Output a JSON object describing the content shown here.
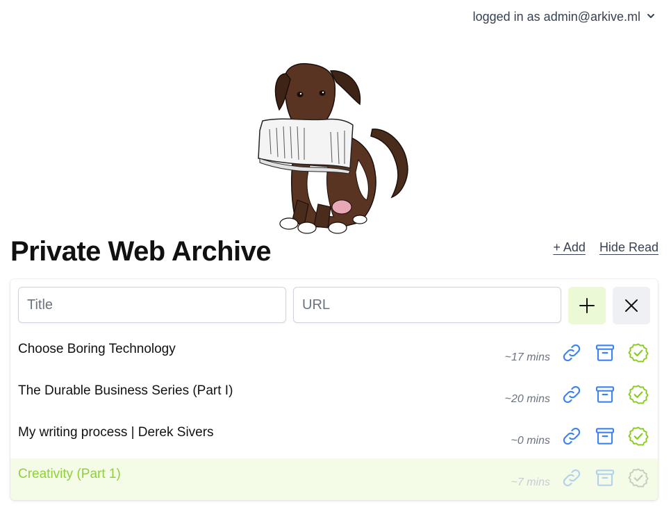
{
  "header": {
    "user_label": "logged in as admin@arkive.ml",
    "dropdown_icon": "chevron-down-icon"
  },
  "logo": {
    "icon": "dog-with-newspaper"
  },
  "page": {
    "title": "Private Web Archive",
    "add_link": "+ Add",
    "hide_read_link": "Hide Read"
  },
  "form": {
    "title_placeholder": "Title",
    "url_placeholder": "URL",
    "add_icon": "plus-icon",
    "close_icon": "close-icon"
  },
  "articles": [
    {
      "title": "Choose Boring Technology",
      "time": "~17 mins",
      "read": false
    },
    {
      "title": "The Durable Business Series (Part I)",
      "time": "~20 mins",
      "read": false
    },
    {
      "title": "My writing process | Derek Sivers",
      "time": "~0 mins",
      "read": false
    },
    {
      "title": "Creativity (Part 1)",
      "time": "~7 mins",
      "read": true
    }
  ],
  "colors": {
    "accent_blue": "#3b82f6",
    "accent_green": "#84cc16",
    "read_row_bg": "#f4fce7",
    "add_button_bg": "#ecf9d6"
  }
}
